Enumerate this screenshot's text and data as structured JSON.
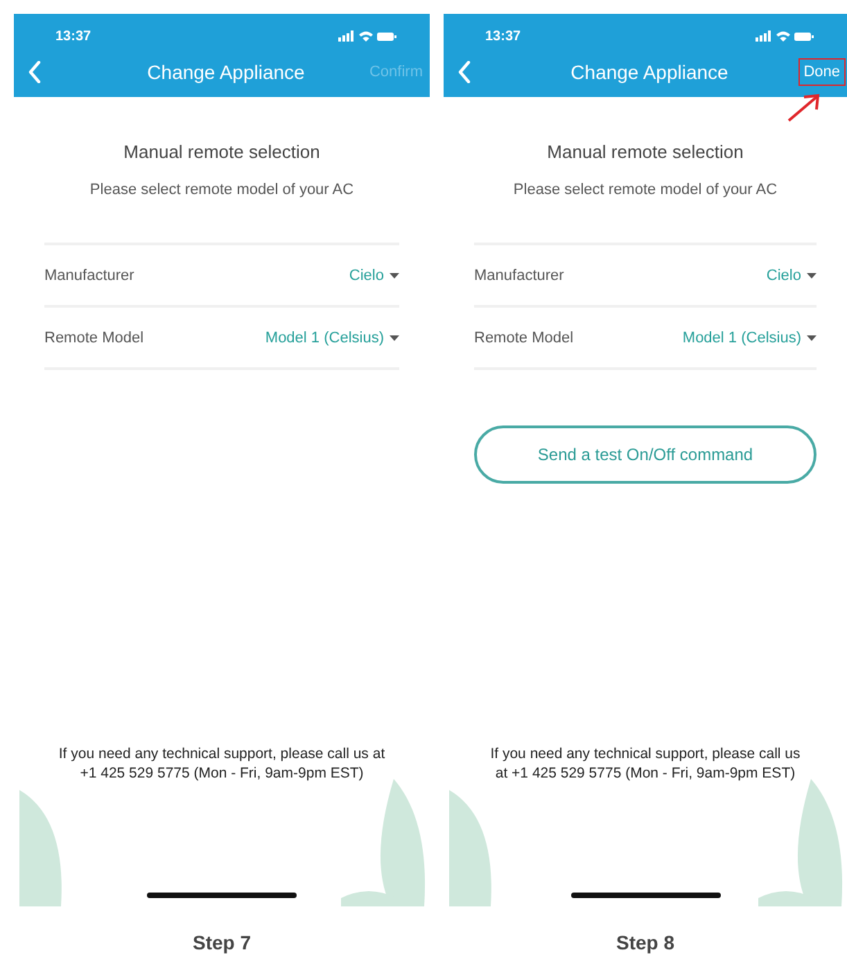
{
  "screens": [
    {
      "status_bar": {
        "time": "13:37"
      },
      "header": {
        "title": "Change Appliance",
        "action": {
          "label": "Confirm",
          "disabled": true,
          "highlighted": false
        }
      },
      "heading": "Manual remote selection",
      "subheading": "Please select remote model of your AC",
      "fields": [
        {
          "label": "Manufacturer",
          "value": "Cielo"
        },
        {
          "label": "Remote Model",
          "value": "Model 1 (Celsius)"
        }
      ],
      "support_text": "If you need any technical support, please call us at +1 425 529 5775 (Mon - Fri, 9am-9pm EST)",
      "step_label": "Step 7"
    },
    {
      "status_bar": {
        "time": "13:37"
      },
      "header": {
        "title": "Change Appliance",
        "action": {
          "label": "Done",
          "disabled": false,
          "highlighted": true
        }
      },
      "heading": "Manual remote selection",
      "subheading": "Please select remote model of your AC",
      "fields": [
        {
          "label": "Manufacturer",
          "value": "Cielo"
        },
        {
          "label": "Remote Model",
          "value": "Model 1 (Celsius)"
        }
      ],
      "test_button": "Send a test On/Off command",
      "support_text": "If you need any technical support, please call us at +1 425 529 5775 (Mon - Fri, 9am-9pm EST)",
      "step_label": "Step 8"
    }
  ]
}
